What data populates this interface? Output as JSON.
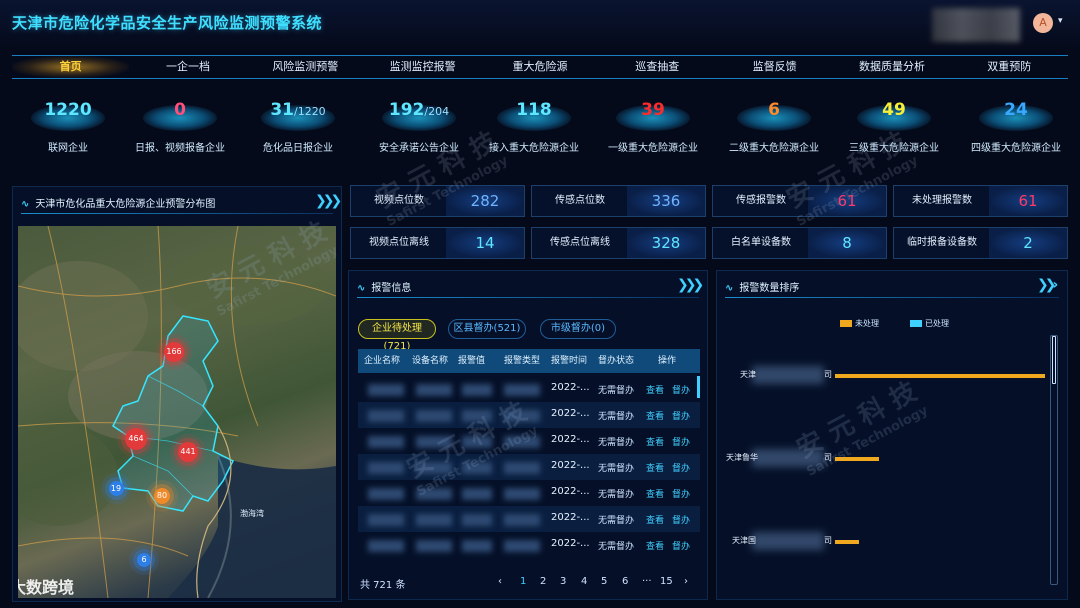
{
  "header": {
    "title": "天津市危险化学品安全生产风险监测预警系统",
    "avatar_letter": "A",
    "caret": "▾"
  },
  "nav": {
    "tabs": [
      "首页",
      "一企一档",
      "风险监测预警",
      "监测监控报警",
      "重大危险源",
      "巡查抽查",
      "监督反馈",
      "数据质量分析",
      "双重预防"
    ]
  },
  "stats": [
    {
      "value": "1220",
      "sub": "",
      "label": "联网企业",
      "color": "#5fe7ff"
    },
    {
      "value": "0",
      "sub": "",
      "label": "日报、视频报备企业",
      "color": "#ff4f7a"
    },
    {
      "value": "31",
      "sub": "/1220",
      "label": "危化品日报企业",
      "color": "#5fe7ff"
    },
    {
      "value": "192",
      "sub": "/204",
      "label": "安全承诺公告企业",
      "color": "#5fe7ff"
    },
    {
      "value": "118",
      "sub": "",
      "label": "接入重大危险源企业",
      "color": "#5fe7ff"
    },
    {
      "value": "39",
      "sub": "",
      "label": "一级重大危险源企业",
      "color": "#ff2a2a"
    },
    {
      "value": "6",
      "sub": "",
      "label": "二级重大危险源企业",
      "color": "#ff8a2a"
    },
    {
      "value": "49",
      "sub": "",
      "label": "三级重大危险源企业",
      "color": "#f6ef3a"
    },
    {
      "value": "24",
      "sub": "",
      "label": "四级重大危险源企业",
      "color": "#39a8ff"
    }
  ],
  "map_panel": {
    "title": "天津市危化品重大危险源企业预警分布图",
    "clusters": [
      {
        "count": "166",
        "color": "#e23a3a"
      },
      {
        "count": "464",
        "color": "#e23a3a"
      },
      {
        "count": "441",
        "color": "#e23a3a"
      },
      {
        "count": "19",
        "color": "#2d7ee6"
      },
      {
        "count": "80",
        "color": "#ef8a2a"
      },
      {
        "count": "6",
        "color": "#2d7ee6"
      }
    ],
    "sea_label": "渤海湾",
    "watermark": "大数跨境"
  },
  "metrics": [
    {
      "label": "视频点位数",
      "value": "282",
      "color": "#6fb4ff"
    },
    {
      "label": "传感点位数",
      "value": "336",
      "color": "#6fb4ff"
    },
    {
      "label": "传感报警数",
      "value": "61",
      "color": "#ff3a6a"
    },
    {
      "label": "未处理报警数",
      "value": "61",
      "color": "#ff3a6a"
    },
    {
      "label": "视频点位离线",
      "value": "14",
      "color": "#5fe7ff"
    },
    {
      "label": "传感点位离线",
      "value": "328",
      "color": "#5fe7ff"
    },
    {
      "label": "白名单设备数",
      "value": "8",
      "color": "#5fe7ff"
    },
    {
      "label": "临时报备设备数",
      "value": "2",
      "color": "#5fe7ff"
    }
  ],
  "alarm": {
    "title": "报警信息",
    "filters": [
      "企业待处理(721)",
      "区县督办(521)",
      "市级督办(0)"
    ],
    "columns": [
      "企业名称",
      "设备名称",
      "报警值",
      "报警类型",
      "报警时间",
      "督办状态",
      "操作"
    ],
    "rows": [
      {
        "time": "2022-...",
        "status": "无需督办",
        "view": "查看",
        "act": "督办"
      },
      {
        "time": "2022-...",
        "status": "无需督办",
        "view": "查看",
        "act": "督办"
      },
      {
        "time": "2022-...",
        "status": "无需督办",
        "view": "查看",
        "act": "督办"
      },
      {
        "time": "2022-...",
        "status": "无需督办",
        "view": "查看",
        "act": "督办"
      },
      {
        "time": "2022-...",
        "status": "无需督办",
        "view": "查看",
        "act": "督办"
      },
      {
        "time": "2022-...",
        "status": "无需督办",
        "view": "查看",
        "act": "督办"
      },
      {
        "time": "2022-...",
        "status": "无需督办",
        "view": "查看",
        "act": "督办"
      }
    ],
    "pager": {
      "total": "共 721 条",
      "prev": "‹",
      "next": "›",
      "pages": [
        "1",
        "2",
        "3",
        "4",
        "5",
        "6",
        "···",
        "15"
      ],
      "current": "1"
    }
  },
  "ranking": {
    "title": "报警数量排序",
    "legend": [
      {
        "label": "未处理",
        "color": "#f0a81f"
      },
      {
        "label": "已处理",
        "color": "#3ed0ff"
      }
    ],
    "rows": [
      {
        "prefix": "天津",
        "suffix": "司",
        "unprocessed": 62
      },
      {
        "prefix": "天津鲁华",
        "suffix": "司",
        "unprocessed": 13
      },
      {
        "prefix": "天津国",
        "suffix": "司",
        "unprocessed": 7
      }
    ],
    "max": 65
  },
  "watermark": {
    "cn": "安 元 科 技",
    "en": "Safirst Technology"
  }
}
